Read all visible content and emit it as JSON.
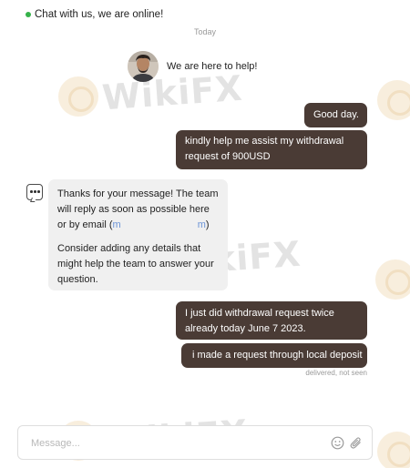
{
  "header": {
    "status_text": "Chat with us, we are online!",
    "status_color": "#36b24a"
  },
  "date_separator": "Today",
  "agent": {
    "intro": "We are here to help!"
  },
  "messages": [
    {
      "direction": "out",
      "text": "Good day."
    },
    {
      "direction": "out",
      "text": "kindly help me assist my withdrawal request of 900USD"
    },
    {
      "direction": "in",
      "text_part1": "Thanks for your message! The team will reply as soon as possible here or by email (",
      "email_start": "m",
      "email_end": "m",
      "text_part2": ")",
      "text_secondary": "Consider adding any details that might help the team to answer your question."
    },
    {
      "direction": "out",
      "text": "I just did withdrawal request twice already today June 7 2023."
    },
    {
      "direction": "out",
      "text": "i made a request through local deposit"
    }
  ],
  "delivery_status": "delivered, not seen",
  "composer": {
    "placeholder": "Message..."
  },
  "icons": {
    "bot": "chat-bot-icon",
    "emoji": "emoji-icon",
    "attach": "paperclip-icon"
  },
  "colors": {
    "outgoing_bubble": "#4a3b35",
    "incoming_bubble": "#f0f0f0"
  },
  "watermark": "WikiFX"
}
